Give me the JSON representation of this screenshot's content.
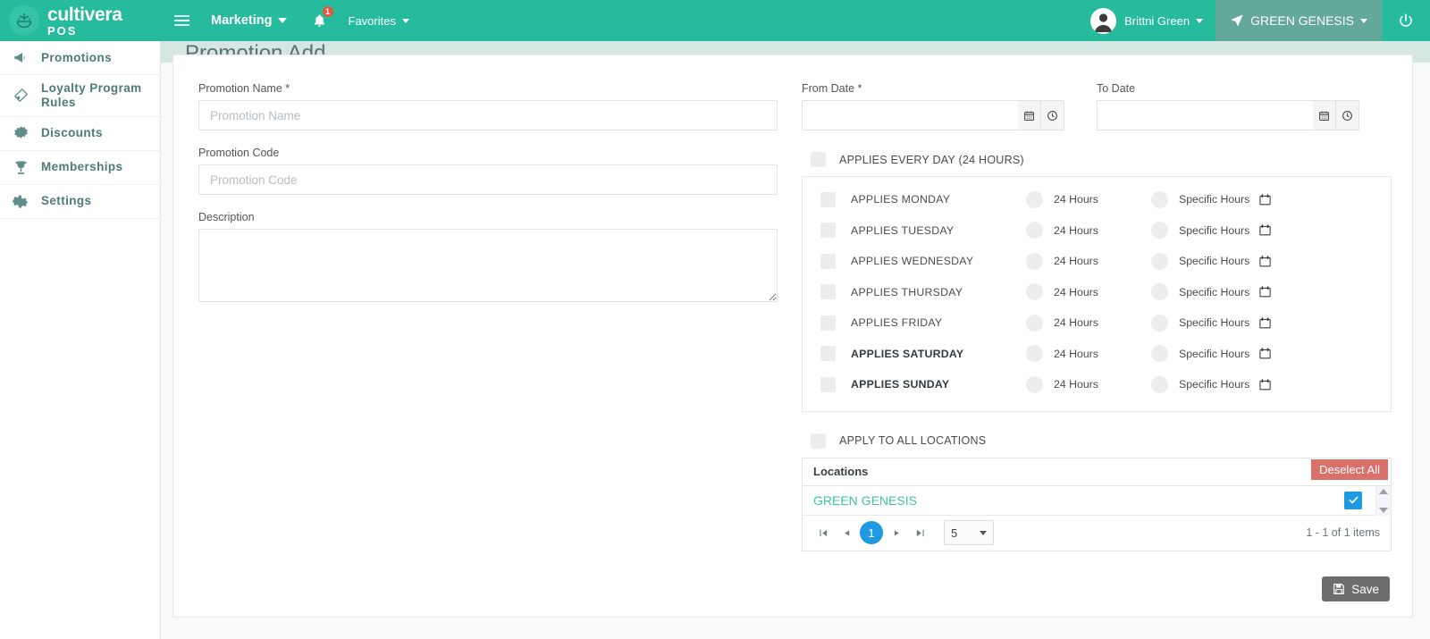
{
  "topbar": {
    "logo_line1": "cultivera",
    "logo_line2": "POS",
    "menu_marketing": "Marketing",
    "menu_favorites": "Favorites",
    "notification_count": "1",
    "user_name": "Brittni Green",
    "store_name": "GREEN GENESIS",
    "accent_color": "#26bb9c",
    "store_chip_color": "#64a79b"
  },
  "sidebar": {
    "items": [
      {
        "label": "Promotions",
        "icon": "megaphone-icon"
      },
      {
        "label": "Loyalty Program Rules",
        "icon": "ticket-icon"
      },
      {
        "label": "Discounts",
        "icon": "starburst-icon"
      },
      {
        "label": "Memberships",
        "icon": "trophy-icon"
      },
      {
        "label": "Settings",
        "icon": "gear-icon"
      }
    ]
  },
  "page": {
    "title": "Promotion Add"
  },
  "form": {
    "promotion_name_label": "Promotion Name *",
    "promotion_name_placeholder": "Promotion Name",
    "promotion_name_value": "",
    "promotion_code_label": "Promotion Code",
    "promotion_code_placeholder": "Promotion Code",
    "promotion_code_value": "",
    "description_label": "Description",
    "description_value": "",
    "from_date_label": "From Date *",
    "from_date_value": "",
    "to_date_label": "To Date",
    "to_date_value": "",
    "applies_every_day_label": "APPLIES EVERY DAY (24 HOURS)",
    "applies_every_day_checked": false,
    "apply_all_locations_label": "APPLY TO ALL LOCATIONS",
    "apply_all_locations_checked": false,
    "hours_24_label": "24 Hours",
    "specific_hours_label": "Specific Hours",
    "days": [
      {
        "label": "APPLIES MONDAY",
        "checked": false,
        "mode": "none",
        "emphasis": false
      },
      {
        "label": "APPLIES TUESDAY",
        "checked": false,
        "mode": "none",
        "emphasis": false
      },
      {
        "label": "APPLIES WEDNESDAY",
        "checked": false,
        "mode": "none",
        "emphasis": false
      },
      {
        "label": "APPLIES THURSDAY",
        "checked": false,
        "mode": "none",
        "emphasis": false
      },
      {
        "label": "APPLIES FRIDAY",
        "checked": false,
        "mode": "none",
        "emphasis": false
      },
      {
        "label": "APPLIES SATURDAY",
        "checked": false,
        "mode": "none",
        "emphasis": true
      },
      {
        "label": "APPLIES SUNDAY",
        "checked": false,
        "mode": "none",
        "emphasis": true
      }
    ]
  },
  "locations": {
    "header_label": "Locations",
    "deselect_all_label": "Deselect All",
    "rows": [
      {
        "name": "GREEN GENESIS",
        "selected": true
      }
    ],
    "pager": {
      "current_page": "1",
      "page_size": "5",
      "info": "1 - 1 of 1 items"
    },
    "selected_color": "#1f9ae0",
    "deselect_color": "#d9706a"
  },
  "actions": {
    "save_label": "Save"
  }
}
